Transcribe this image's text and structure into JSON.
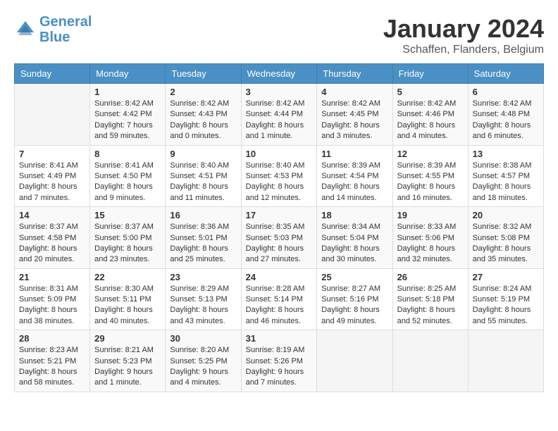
{
  "header": {
    "logo_line1": "General",
    "logo_line2": "Blue",
    "month": "January 2024",
    "location": "Schaffen, Flanders, Belgium"
  },
  "days_of_week": [
    "Sunday",
    "Monday",
    "Tuesday",
    "Wednesday",
    "Thursday",
    "Friday",
    "Saturday"
  ],
  "weeks": [
    [
      {
        "day": "",
        "info": ""
      },
      {
        "day": "1",
        "info": "Sunrise: 8:42 AM\nSunset: 4:42 PM\nDaylight: 7 hours\nand 59 minutes."
      },
      {
        "day": "2",
        "info": "Sunrise: 8:42 AM\nSunset: 4:43 PM\nDaylight: 8 hours\nand 0 minutes."
      },
      {
        "day": "3",
        "info": "Sunrise: 8:42 AM\nSunset: 4:44 PM\nDaylight: 8 hours\nand 1 minute."
      },
      {
        "day": "4",
        "info": "Sunrise: 8:42 AM\nSunset: 4:45 PM\nDaylight: 8 hours\nand 3 minutes."
      },
      {
        "day": "5",
        "info": "Sunrise: 8:42 AM\nSunset: 4:46 PM\nDaylight: 8 hours\nand 4 minutes."
      },
      {
        "day": "6",
        "info": "Sunrise: 8:42 AM\nSunset: 4:48 PM\nDaylight: 8 hours\nand 6 minutes."
      }
    ],
    [
      {
        "day": "7",
        "info": "Sunrise: 8:41 AM\nSunset: 4:49 PM\nDaylight: 8 hours\nand 7 minutes."
      },
      {
        "day": "8",
        "info": "Sunrise: 8:41 AM\nSunset: 4:50 PM\nDaylight: 8 hours\nand 9 minutes."
      },
      {
        "day": "9",
        "info": "Sunrise: 8:40 AM\nSunset: 4:51 PM\nDaylight: 8 hours\nand 11 minutes."
      },
      {
        "day": "10",
        "info": "Sunrise: 8:40 AM\nSunset: 4:53 PM\nDaylight: 8 hours\nand 12 minutes."
      },
      {
        "day": "11",
        "info": "Sunrise: 8:39 AM\nSunset: 4:54 PM\nDaylight: 8 hours\nand 14 minutes."
      },
      {
        "day": "12",
        "info": "Sunrise: 8:39 AM\nSunset: 4:55 PM\nDaylight: 8 hours\nand 16 minutes."
      },
      {
        "day": "13",
        "info": "Sunrise: 8:38 AM\nSunset: 4:57 PM\nDaylight: 8 hours\nand 18 minutes."
      }
    ],
    [
      {
        "day": "14",
        "info": "Sunrise: 8:37 AM\nSunset: 4:58 PM\nDaylight: 8 hours\nand 20 minutes."
      },
      {
        "day": "15",
        "info": "Sunrise: 8:37 AM\nSunset: 5:00 PM\nDaylight: 8 hours\nand 23 minutes."
      },
      {
        "day": "16",
        "info": "Sunrise: 8:36 AM\nSunset: 5:01 PM\nDaylight: 8 hours\nand 25 minutes."
      },
      {
        "day": "17",
        "info": "Sunrise: 8:35 AM\nSunset: 5:03 PM\nDaylight: 8 hours\nand 27 minutes."
      },
      {
        "day": "18",
        "info": "Sunrise: 8:34 AM\nSunset: 5:04 PM\nDaylight: 8 hours\nand 30 minutes."
      },
      {
        "day": "19",
        "info": "Sunrise: 8:33 AM\nSunset: 5:06 PM\nDaylight: 8 hours\nand 32 minutes."
      },
      {
        "day": "20",
        "info": "Sunrise: 8:32 AM\nSunset: 5:08 PM\nDaylight: 8 hours\nand 35 minutes."
      }
    ],
    [
      {
        "day": "21",
        "info": "Sunrise: 8:31 AM\nSunset: 5:09 PM\nDaylight: 8 hours\nand 38 minutes."
      },
      {
        "day": "22",
        "info": "Sunrise: 8:30 AM\nSunset: 5:11 PM\nDaylight: 8 hours\nand 40 minutes."
      },
      {
        "day": "23",
        "info": "Sunrise: 8:29 AM\nSunset: 5:13 PM\nDaylight: 8 hours\nand 43 minutes."
      },
      {
        "day": "24",
        "info": "Sunrise: 8:28 AM\nSunset: 5:14 PM\nDaylight: 8 hours\nand 46 minutes."
      },
      {
        "day": "25",
        "info": "Sunrise: 8:27 AM\nSunset: 5:16 PM\nDaylight: 8 hours\nand 49 minutes."
      },
      {
        "day": "26",
        "info": "Sunrise: 8:25 AM\nSunset: 5:18 PM\nDaylight: 8 hours\nand 52 minutes."
      },
      {
        "day": "27",
        "info": "Sunrise: 8:24 AM\nSunset: 5:19 PM\nDaylight: 8 hours\nand 55 minutes."
      }
    ],
    [
      {
        "day": "28",
        "info": "Sunrise: 8:23 AM\nSunset: 5:21 PM\nDaylight: 8 hours\nand 58 minutes."
      },
      {
        "day": "29",
        "info": "Sunrise: 8:21 AM\nSunset: 5:23 PM\nDaylight: 9 hours\nand 1 minute."
      },
      {
        "day": "30",
        "info": "Sunrise: 8:20 AM\nSunset: 5:25 PM\nDaylight: 9 hours\nand 4 minutes."
      },
      {
        "day": "31",
        "info": "Sunrise: 8:19 AM\nSunset: 5:26 PM\nDaylight: 9 hours\nand 7 minutes."
      },
      {
        "day": "",
        "info": ""
      },
      {
        "day": "",
        "info": ""
      },
      {
        "day": "",
        "info": ""
      }
    ]
  ]
}
